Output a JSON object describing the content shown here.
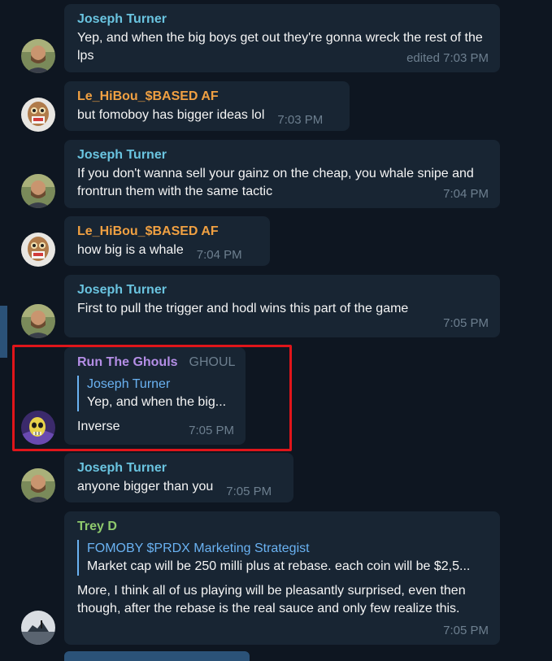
{
  "messages": [
    {
      "sender": "Joseph Turner",
      "text": "Yep, and when the big boys get out they're gonna wreck the rest of the lps",
      "time": "edited 7:03 PM"
    },
    {
      "sender": "Le_HiBou_$BASED AF",
      "text": "but fomoboy has bigger ideas lol",
      "time": "7:03 PM"
    },
    {
      "sender": "Joseph Turner",
      "text": "If you don't wanna sell your gainz on the cheap, you whale snipe and frontrun them with the same tactic",
      "time": "7:04 PM"
    },
    {
      "sender": "Le_HiBou_$BASED AF",
      "text": "how big is a whale",
      "time": "7:04 PM"
    },
    {
      "sender": "Joseph Turner",
      "text": "First to pull the trigger and hodl wins this part of the game",
      "time": "7:05 PM"
    },
    {
      "sender": "Run The Ghouls",
      "tag": "GHOUL",
      "reply_to": {
        "sender": "Joseph Turner",
        "text": "Yep, and when the big..."
      },
      "text": "Inverse",
      "time": "7:05 PM"
    },
    {
      "sender": "Joseph Turner",
      "text": "anyone bigger than you",
      "time": "7:05 PM"
    },
    {
      "sender": "Trey D",
      "reply_to": {
        "sender": "FOMOBY $PRDX Marketing Strategist",
        "text": "Market cap will be 250 milli plus at rebase. each coin will be $2,5..."
      },
      "text": "More, I think all of us playing will be pleasantly surprised, even then though, after the rebase is the real sauce and only few realize this.",
      "time": "7:05 PM"
    }
  ],
  "colors": {
    "background": "#0e1621",
    "bubble": "#182533",
    "joseph": "#6ac4e0",
    "hibou": "#f0a042",
    "ghouls": "#b48ee6",
    "trey": "#8fca6d",
    "reply_accent": "#6ab2f2",
    "highlight": "#e0151a"
  }
}
